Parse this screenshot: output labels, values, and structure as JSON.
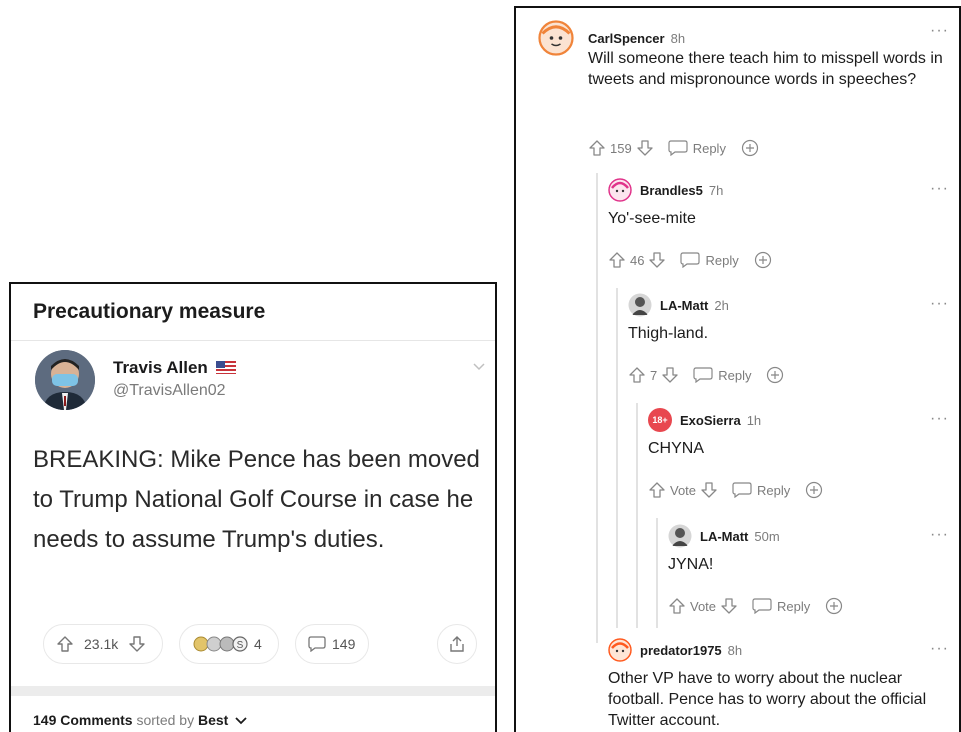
{
  "post": {
    "title": "Precautionary measure",
    "tweet": {
      "name": "Travis Allen",
      "handle": "@TravisAllen02",
      "text": "BREAKING: Mike Pence has been moved to Trump National Golf Course in case he needs to assume Trump's duties."
    },
    "votes": "23.1k",
    "awards_count": "4",
    "comments_count": "149",
    "sort": {
      "count_label": "149 Comments",
      "sorted_by": "sorted by",
      "mode": "Best"
    }
  },
  "comments": [
    {
      "user": "CarlSpencer",
      "time": "8h",
      "text": "Will someone there teach him to misspell words in tweets and mispronounce words in speeches?",
      "score": "159",
      "reply": "Reply"
    },
    {
      "user": "Brandles5",
      "time": "7h",
      "text": "Yo'-see-mite",
      "score": "46",
      "reply": "Reply"
    },
    {
      "user": "LA-Matt",
      "time": "2h",
      "text": "Thigh-land.",
      "score": "7",
      "reply": "Reply"
    },
    {
      "user": "ExoSierra",
      "time": "1h",
      "text": "CHYNA",
      "score": "Vote",
      "reply": "Reply",
      "nsfw_badge": "18+"
    },
    {
      "user": "LA-Matt",
      "time": "50m",
      "text": "JYNA!",
      "score": "Vote",
      "reply": "Reply"
    },
    {
      "user": "predator1975",
      "time": "8h",
      "text": "Other VP have to worry about the nuclear football. Pence has to worry about the official Twitter account."
    }
  ],
  "more_label": "···",
  "colors": {
    "orange": "#ff5a1f",
    "pink": "#e0338a",
    "nsfw_red": "#e8474f"
  }
}
